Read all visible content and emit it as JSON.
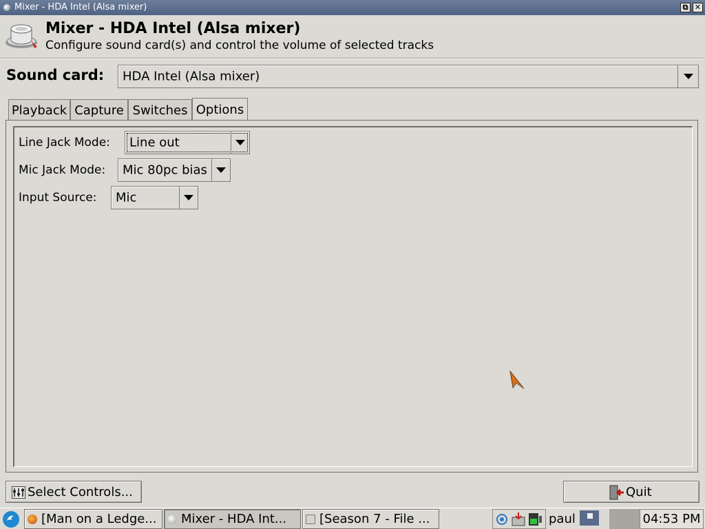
{
  "window": {
    "title": "Mixer - HDA Intel (Alsa mixer)",
    "restore_label": "⧉",
    "close_label": "✕"
  },
  "header": {
    "title": "Mixer - HDA Intel (Alsa mixer)",
    "subtitle": "Configure sound card(s) and control the volume of selected tracks",
    "icon": "speaker-knob-icon"
  },
  "sound_card": {
    "label": "Sound card:",
    "selected": "HDA Intel (Alsa mixer)"
  },
  "tabs": [
    {
      "label": "Playback",
      "active": false
    },
    {
      "label": "Capture",
      "active": false
    },
    {
      "label": "Switches",
      "active": false
    },
    {
      "label": "Options",
      "active": true
    }
  ],
  "options": [
    {
      "label": "Line Jack Mode:",
      "value": "Line out",
      "focused": true
    },
    {
      "label": "Mic Jack Mode:",
      "value": "Mic 80pc bias",
      "focused": false
    },
    {
      "label": "Input Source:",
      "value": "Mic",
      "focused": false
    }
  ],
  "buttons": {
    "select_controls": "Select Controls...",
    "quit": "Quit"
  },
  "taskbar": {
    "tasks": [
      {
        "label": "[Man on a Ledge...",
        "icon": "firefox-icon",
        "active": false
      },
      {
        "label": "Mixer - HDA Int...",
        "icon": "mixer-icon",
        "active": true
      },
      {
        "label": "[Season 7 - File ...",
        "icon": "folder-icon",
        "active": false
      }
    ],
    "user": "paul",
    "clock": "04:53 PM"
  },
  "colors": {
    "titlebar": "#5a6b8c",
    "background": "#dcdad5",
    "accent_arrow": "#d06010"
  }
}
